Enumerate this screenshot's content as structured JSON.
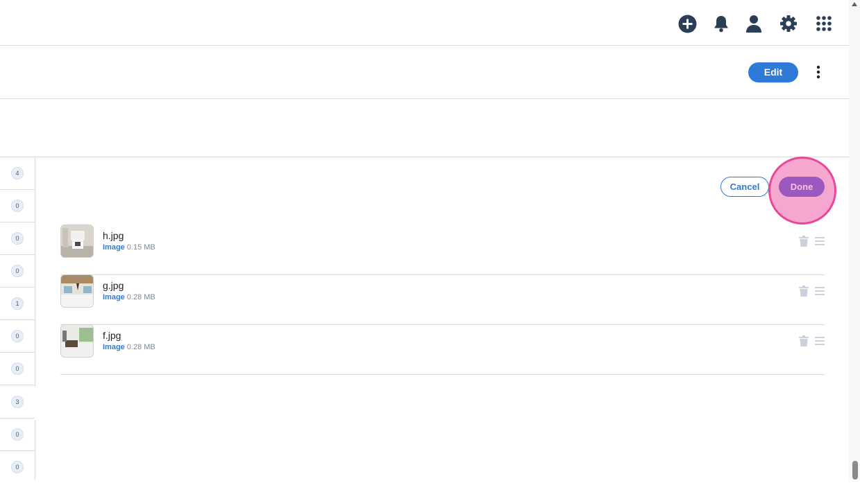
{
  "topbar": {
    "icons": [
      "add-circle-icon",
      "bell-icon",
      "user-icon",
      "gear-icon",
      "apps-grid-icon"
    ]
  },
  "toolbar": {
    "edit_label": "Edit"
  },
  "left_counts": [
    "4",
    "0",
    "0",
    "0",
    "1",
    "0",
    "0",
    "3",
    "0",
    "0"
  ],
  "editor": {
    "cancel_label": "Cancel",
    "done_label": "Done"
  },
  "files": [
    {
      "name": "h.jpg",
      "kind": "Image",
      "size": "0.15 MB"
    },
    {
      "name": "g.jpg",
      "kind": "Image",
      "size": "0.28 MB"
    },
    {
      "name": "f.jpg",
      "kind": "Image",
      "size": "0.28 MB"
    }
  ],
  "colors": {
    "accent": "#2f7ad8",
    "icon": "#2c3e55",
    "highlight": "#f6a7cf",
    "done": "#9b59c0"
  }
}
